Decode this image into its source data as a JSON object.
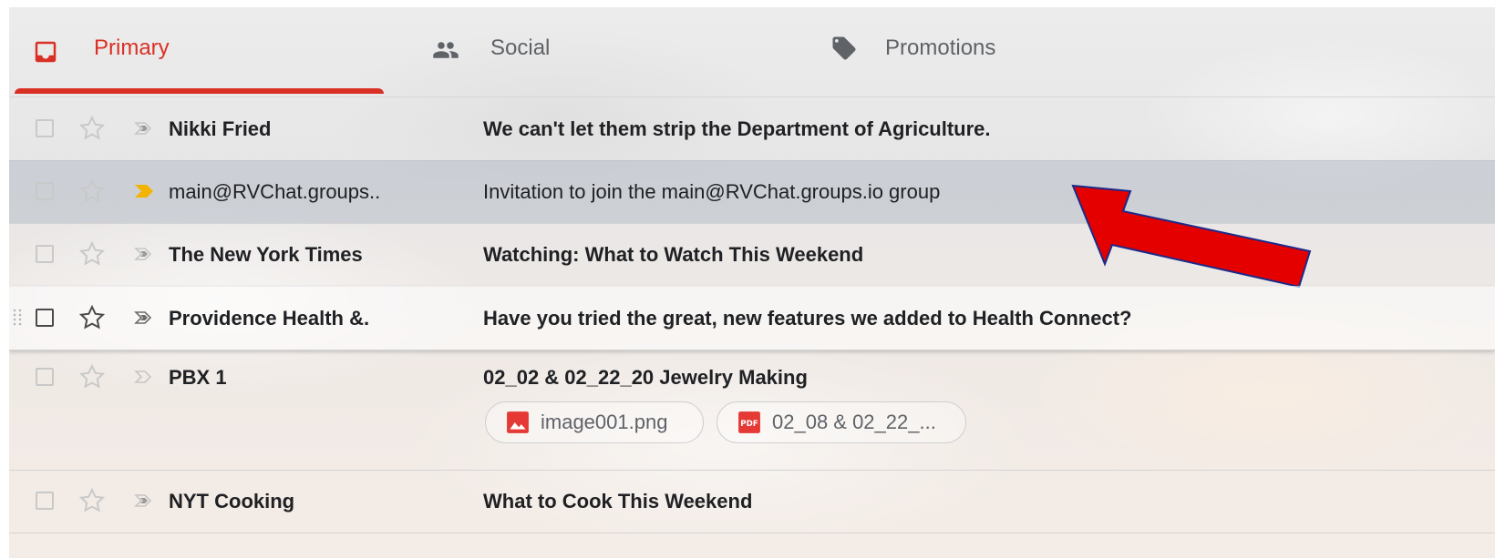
{
  "tabs": [
    {
      "label": "Primary",
      "icon": "inbox-icon",
      "active": true,
      "color": "#d93025"
    },
    {
      "label": "Social",
      "icon": "people-icon",
      "active": false
    },
    {
      "label": "Promotions",
      "icon": "tag-icon",
      "active": false
    }
  ],
  "rows": [
    {
      "sender": "Nikki Fried",
      "subject": "We can't let them strip the Department of Agriculture.",
      "unread": true,
      "important": false
    },
    {
      "sender": "main@RVChat.groups..",
      "subject": "Invitation to join the main@RVChat.groups.io group",
      "unread": false,
      "important": true,
      "important_color": "#f2b400"
    },
    {
      "sender": "The New York Times",
      "subject": "Watching: What to Watch This Weekend",
      "unread": true,
      "important": false
    },
    {
      "sender": "Providence Health &.",
      "subject": "Have you tried the great, new features we added to Health Connect?",
      "unread": true,
      "important": false
    },
    {
      "sender": "PBX 1",
      "subject": "02_02 & 02_22_20 Jewelry Making",
      "unread": true,
      "important": false,
      "attachments": [
        {
          "name": "image001.png",
          "icon": "image-file-icon"
        },
        {
          "name": "02_08 & 02_22_...",
          "icon": "pdf-file-icon"
        }
      ]
    },
    {
      "sender": "NYT Cooking",
      "subject": "What to Cook This Weekend",
      "unread": true,
      "important": false
    }
  ],
  "annotation": {
    "type": "arrow",
    "color": "#e50000"
  }
}
